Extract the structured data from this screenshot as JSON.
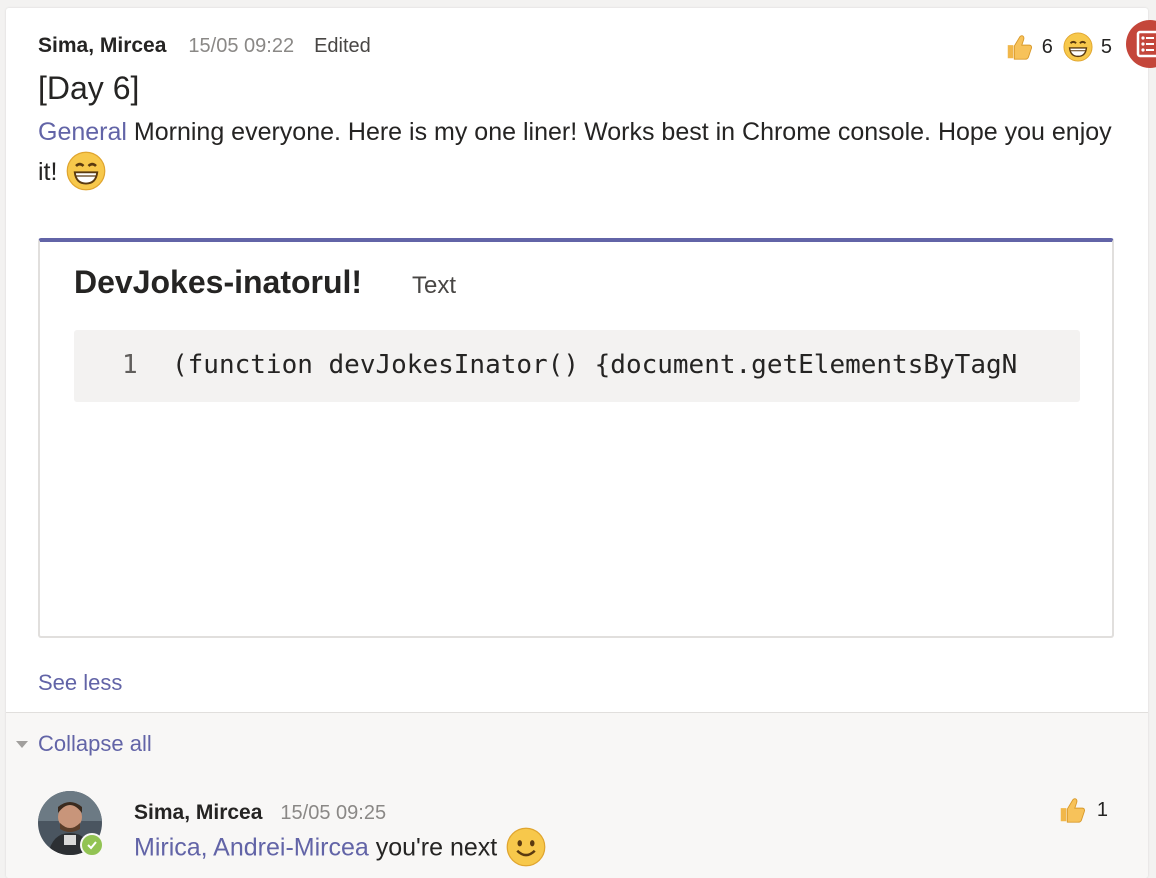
{
  "post": {
    "author": "Sima, Mircea",
    "timestamp": "15/05 09:22",
    "edited_label": "Edited",
    "subject": "[Day 6]",
    "mention": "General",
    "body": " Morning everyone. Here is my one liner! Works best in Chrome console. Hope you enjoy it!",
    "reactions": [
      {
        "icon": "thumbs-up-icon",
        "count": "6"
      },
      {
        "icon": "grin-icon",
        "count": "5"
      }
    ],
    "snippet": {
      "title": "DevJokes-inatorul!",
      "language": "Text",
      "line_number": "1",
      "code": "(function devJokesInator() {document.getElementsByTagN"
    },
    "see_less_label": "See less"
  },
  "replies": {
    "collapse_label": "Collapse all",
    "items": [
      {
        "author": "Sima, Mircea",
        "timestamp": "15/05 09:25",
        "mention": "Mirica, Andrei-Mircea",
        "text": " you're next",
        "reaction": {
          "icon": "thumbs-up-icon",
          "count": "1"
        }
      }
    ]
  },
  "colors": {
    "accent": "#6264a7",
    "presence": "#92c353",
    "side_button": "#c4463a"
  }
}
